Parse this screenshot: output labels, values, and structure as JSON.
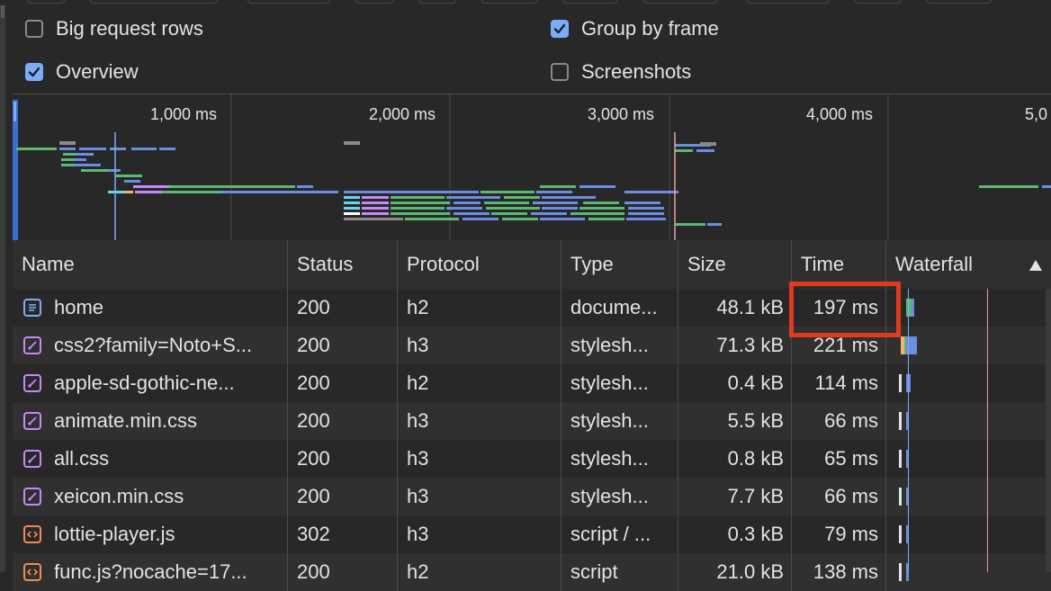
{
  "settings": {
    "big_request_rows": {
      "label": "Big request rows",
      "checked": false
    },
    "group_by_frame": {
      "label": "Group by frame",
      "checked": true
    },
    "overview": {
      "label": "Overview",
      "checked": true
    },
    "screenshots": {
      "label": "Screenshots",
      "checked": false
    }
  },
  "overview": {
    "ticks": [
      "1,000 ms",
      "2,000 ms",
      "3,000 ms",
      "4,000 ms",
      "5,0"
    ]
  },
  "table": {
    "columns": [
      "Name",
      "Status",
      "Protocol",
      "Type",
      "Size",
      "Time",
      "Waterfall"
    ],
    "rows": [
      {
        "icon": "document-icon",
        "name": "home",
        "status": "200",
        "protocol": "h2",
        "type": "docume...",
        "size": "48.1 kB",
        "time": "197 ms"
      },
      {
        "icon": "stylesheet-icon",
        "name": "css2?family=Noto+S...",
        "status": "200",
        "protocol": "h3",
        "type": "stylesh...",
        "size": "71.3 kB",
        "time": "221 ms"
      },
      {
        "icon": "stylesheet-icon",
        "name": "apple-sd-gothic-ne...",
        "status": "200",
        "protocol": "h2",
        "type": "stylesh...",
        "size": "0.4 kB",
        "time": "114 ms"
      },
      {
        "icon": "stylesheet-icon",
        "name": "animate.min.css",
        "status": "200",
        "protocol": "h3",
        "type": "stylesh...",
        "size": "5.5 kB",
        "time": "66 ms"
      },
      {
        "icon": "stylesheet-icon",
        "name": "all.css",
        "status": "200",
        "protocol": "h3",
        "type": "stylesh...",
        "size": "0.8 kB",
        "time": "65 ms"
      },
      {
        "icon": "stylesheet-icon",
        "name": "xeicon.min.css",
        "status": "200",
        "protocol": "h3",
        "type": "stylesh...",
        "size": "7.7 kB",
        "time": "66 ms"
      },
      {
        "icon": "script-icon",
        "name": "lottie-player.js",
        "status": "302",
        "protocol": "h3",
        "type": "script / ...",
        "size": "0.3 kB",
        "time": "79 ms"
      },
      {
        "icon": "script-icon",
        "name": "func.js?nocache=17...",
        "status": "200",
        "protocol": "h2",
        "type": "script",
        "size": "21.0 kB",
        "time": "138 ms"
      }
    ]
  },
  "colors": {
    "accent": "#7cacf8",
    "highlight": "#e03a1f",
    "bar_green": "#5bb974",
    "bar_blue": "#6b8de3",
    "bar_purple": "#c58af9",
    "bar_cyan": "#67d4f2",
    "bar_gray": "#8a8a8a"
  }
}
